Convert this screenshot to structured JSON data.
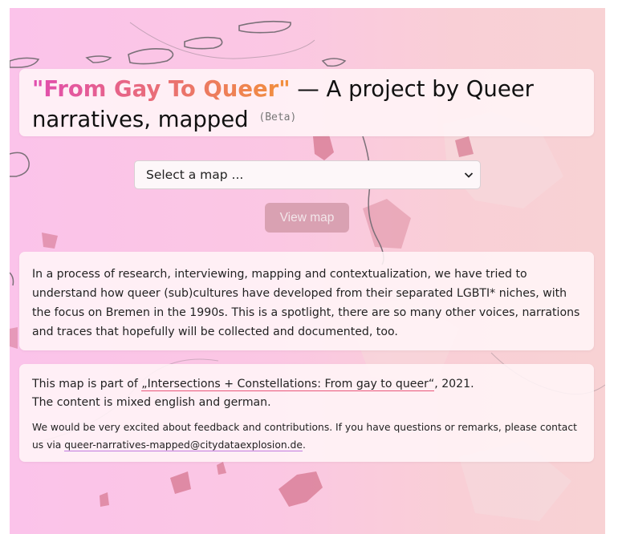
{
  "header": {
    "title_highlight": "\"From Gay To Queer\"",
    "title_rest": " — A project by Queer narratives, mapped",
    "beta": "(Beta)"
  },
  "map_select": {
    "selected": "Select a map ..."
  },
  "view_button": {
    "label": "View map"
  },
  "description": {
    "text": "In a process of research, interviewing, mapping and contextualization, we have tried to understand how queer (sub)cultures have developed from their separated LGBTI* niches, with the focus on Bremen in the 1990s. This is a spotlight, there are so many other voices, narrations and traces that hopefully will be collected and documented, too."
  },
  "info": {
    "line1_prefix": "This map is part of ",
    "line1_link": "„Intersections + Constellations: From gay to queer“",
    "line1_suffix": ", 2021.",
    "line2": "The content is mixed english and german.",
    "line3_prefix": "We would be very excited about feedback and contributions. If you have questions or remarks, please contact us via ",
    "line3_email": "queer-narratives-mapped@citydataexplosion.de",
    "line3_suffix": "."
  },
  "colors": {
    "background_left": "#fbc3ea",
    "background_right": "#f8d2d4",
    "title_gradient_start": "#e14db0",
    "title_gradient_end": "#f2903a",
    "map_shape": "#d6768f",
    "button_bg": "#d9a1b2",
    "link_underline": "#e8567a"
  }
}
